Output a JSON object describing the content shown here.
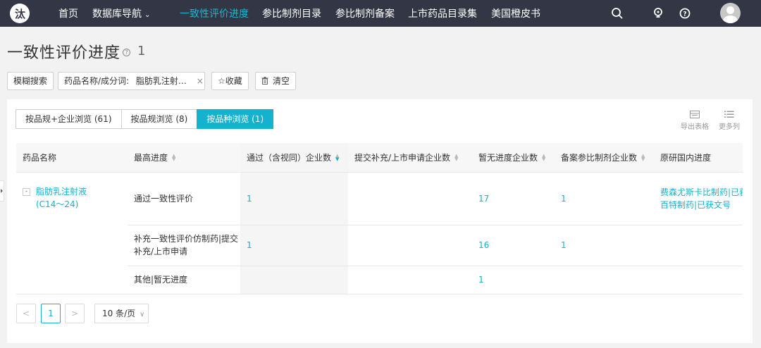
{
  "nav": {
    "logo_glyph": "汰",
    "items": [
      {
        "label": "首页"
      },
      {
        "label": "数据库导航",
        "caret": "⌄"
      },
      {
        "label": "一致性评价进度"
      },
      {
        "label": "参比制剂目录"
      },
      {
        "label": "参比制剂备案"
      },
      {
        "label": "上市药品目录集"
      },
      {
        "label": "美国橙皮书"
      }
    ],
    "active_index": 2,
    "icons": [
      "search-icon",
      "bulb-icon",
      "help-circle-icon",
      "avatar"
    ]
  },
  "page": {
    "title": "一致性评价进度",
    "help_glyph": "?",
    "count": "1"
  },
  "filters": {
    "fuzzy_search": "模糊搜索",
    "tag_label": "药品名称/成分词:",
    "tag_value": "脂肪乳注射…",
    "tag_remove": "×",
    "favorite": "☆收藏",
    "clear": "清空"
  },
  "tabs": [
    {
      "label": "按品规+企业浏览 (61)"
    },
    {
      "label": "按品规浏览 (8)"
    },
    {
      "label": "按品种浏览 (1)"
    }
  ],
  "tools": {
    "export": "导出表格",
    "more_columns": "更多列"
  },
  "table": {
    "headers": [
      {
        "label": "药品名称"
      },
      {
        "label": "最高进度"
      },
      {
        "label": "通过（含视同）企业数"
      },
      {
        "label": "提交补充/上市申请企业数"
      },
      {
        "label": "暂无进度企业数"
      },
      {
        "label": "备案参比制剂企业数"
      },
      {
        "label": "原研国内进度"
      }
    ],
    "drug": {
      "expand": "-",
      "name": "脂肪乳注射液(C14～24)"
    },
    "rows": [
      {
        "progress": "通过一致性评价",
        "passed": "1",
        "submitted": "",
        "no_progress": "17",
        "ref_filing": "1",
        "original": [
          "费森尤斯卡比制药|已获文号",
          "百特制药|已获文号"
        ]
      },
      {
        "progress": "补充一致性评价仿制药|提交补充/上市申请",
        "passed": "1",
        "submitted": "",
        "no_progress": "16",
        "ref_filing": "1",
        "original": []
      },
      {
        "progress": "其他|暂无进度",
        "passed": "",
        "submitted": "",
        "no_progress": "1",
        "ref_filing": "",
        "original": []
      }
    ]
  },
  "pagination": {
    "prev": "<",
    "current": "1",
    "next": ">",
    "page_size": "10 条/页"
  },
  "colors": {
    "nav_bg": "#333745",
    "accent": "#14b2cf",
    "page_bg": "#f2f2f2"
  }
}
